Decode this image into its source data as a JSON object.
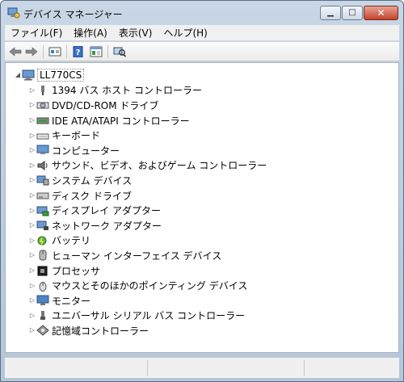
{
  "window": {
    "title": "デバイス マネージャー",
    "icon": "device-manager-icon"
  },
  "menu": [
    {
      "label": "ファイル(F)"
    },
    {
      "label": "操作(A)"
    },
    {
      "label": "表示(V)"
    },
    {
      "label": "ヘルプ(H)"
    }
  ],
  "toolbar": {
    "back": "arrow-left-icon",
    "forward": "arrow-right-icon",
    "properties": "properties-icon",
    "help": "help-icon",
    "view": "view-icon",
    "scan": "scan-hardware-icon"
  },
  "tree": {
    "root": {
      "label": "LL770CS",
      "icon": "computer-icon"
    },
    "items": [
      {
        "label": "1394 バス ホスト コントローラー",
        "icon": "1394-controller-icon"
      },
      {
        "label": "DVD/CD-ROM ドライブ",
        "icon": "dvd-drive-icon"
      },
      {
        "label": "IDE ATA/ATAPI コントローラー",
        "icon": "ide-controller-icon"
      },
      {
        "label": "キーボード",
        "icon": "keyboard-icon"
      },
      {
        "label": "コンピューター",
        "icon": "computer-icon"
      },
      {
        "label": "サウンド、ビデオ、およびゲーム コントローラー",
        "icon": "sound-icon"
      },
      {
        "label": "システム デバイス",
        "icon": "system-device-icon"
      },
      {
        "label": "ディスク ドライブ",
        "icon": "disk-drive-icon"
      },
      {
        "label": "ディスプレイ アダプター",
        "icon": "display-adapter-icon"
      },
      {
        "label": "ネットワーク アダプター",
        "icon": "network-adapter-icon"
      },
      {
        "label": "バッテリ",
        "icon": "battery-icon"
      },
      {
        "label": "ヒューマン インターフェイス デバイス",
        "icon": "hid-icon"
      },
      {
        "label": "プロセッサ",
        "icon": "processor-icon"
      },
      {
        "label": "マウスとそのほかのポインティング デバイス",
        "icon": "mouse-icon"
      },
      {
        "label": "モニター",
        "icon": "monitor-icon"
      },
      {
        "label": "ユニバーサル シリアル バス コントローラー",
        "icon": "usb-icon"
      },
      {
        "label": "記憶域コントローラー",
        "icon": "storage-controller-icon"
      }
    ]
  },
  "colors": {
    "titlebar": "#c8d6e6",
    "close_button": "#c4432b",
    "selection_border": "#888888"
  }
}
